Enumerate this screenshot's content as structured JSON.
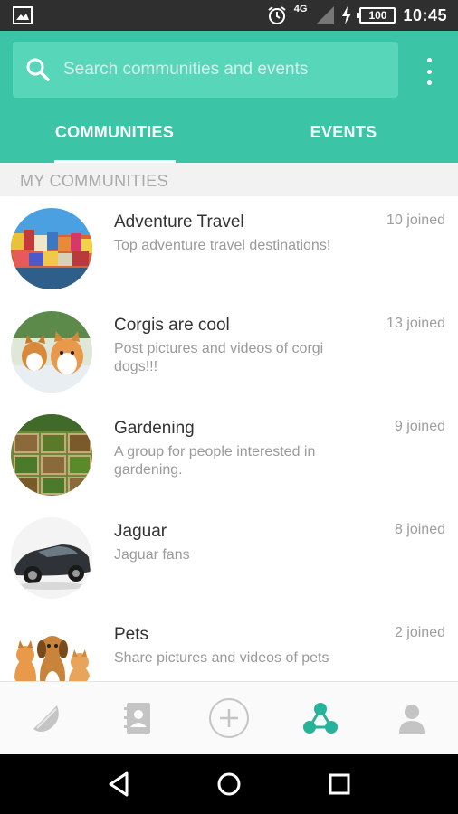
{
  "status_bar": {
    "network": "4G",
    "battery": "100",
    "time": "10:45"
  },
  "search": {
    "placeholder": "Search communities and events"
  },
  "tabs": [
    {
      "label": "COMMUNITIES",
      "active": true
    },
    {
      "label": "EVENTS",
      "active": false
    }
  ],
  "section": {
    "title": "MY COMMUNITIES"
  },
  "communities": [
    {
      "name": "Adventure Travel",
      "description": "Top adventure travel destinations!",
      "joined": "10 joined"
    },
    {
      "name": "Corgis are cool",
      "description": "Post pictures and videos of corgi dogs!!!",
      "joined": "13 joined"
    },
    {
      "name": "Gardening",
      "description": "A group for people interested in gardening.",
      "joined": "9 joined"
    },
    {
      "name": "Jaguar",
      "description": "Jaguar fans",
      "joined": "8 joined"
    },
    {
      "name": "Pets",
      "description": "Share pictures and videos of pets",
      "joined": "2 joined"
    }
  ],
  "bottom_nav": [
    {
      "icon": "watermelon-icon",
      "active": false
    },
    {
      "icon": "contacts-book-icon",
      "active": false
    },
    {
      "icon": "add-circle-icon",
      "active": false
    },
    {
      "icon": "communities-icon",
      "active": true
    },
    {
      "icon": "profile-icon",
      "active": false
    }
  ],
  "colors": {
    "brand": "#3cc4a6",
    "search_bg": "#58d6ba",
    "active_nav": "#26b39a",
    "inactive_nav": "#c4c4c4"
  }
}
